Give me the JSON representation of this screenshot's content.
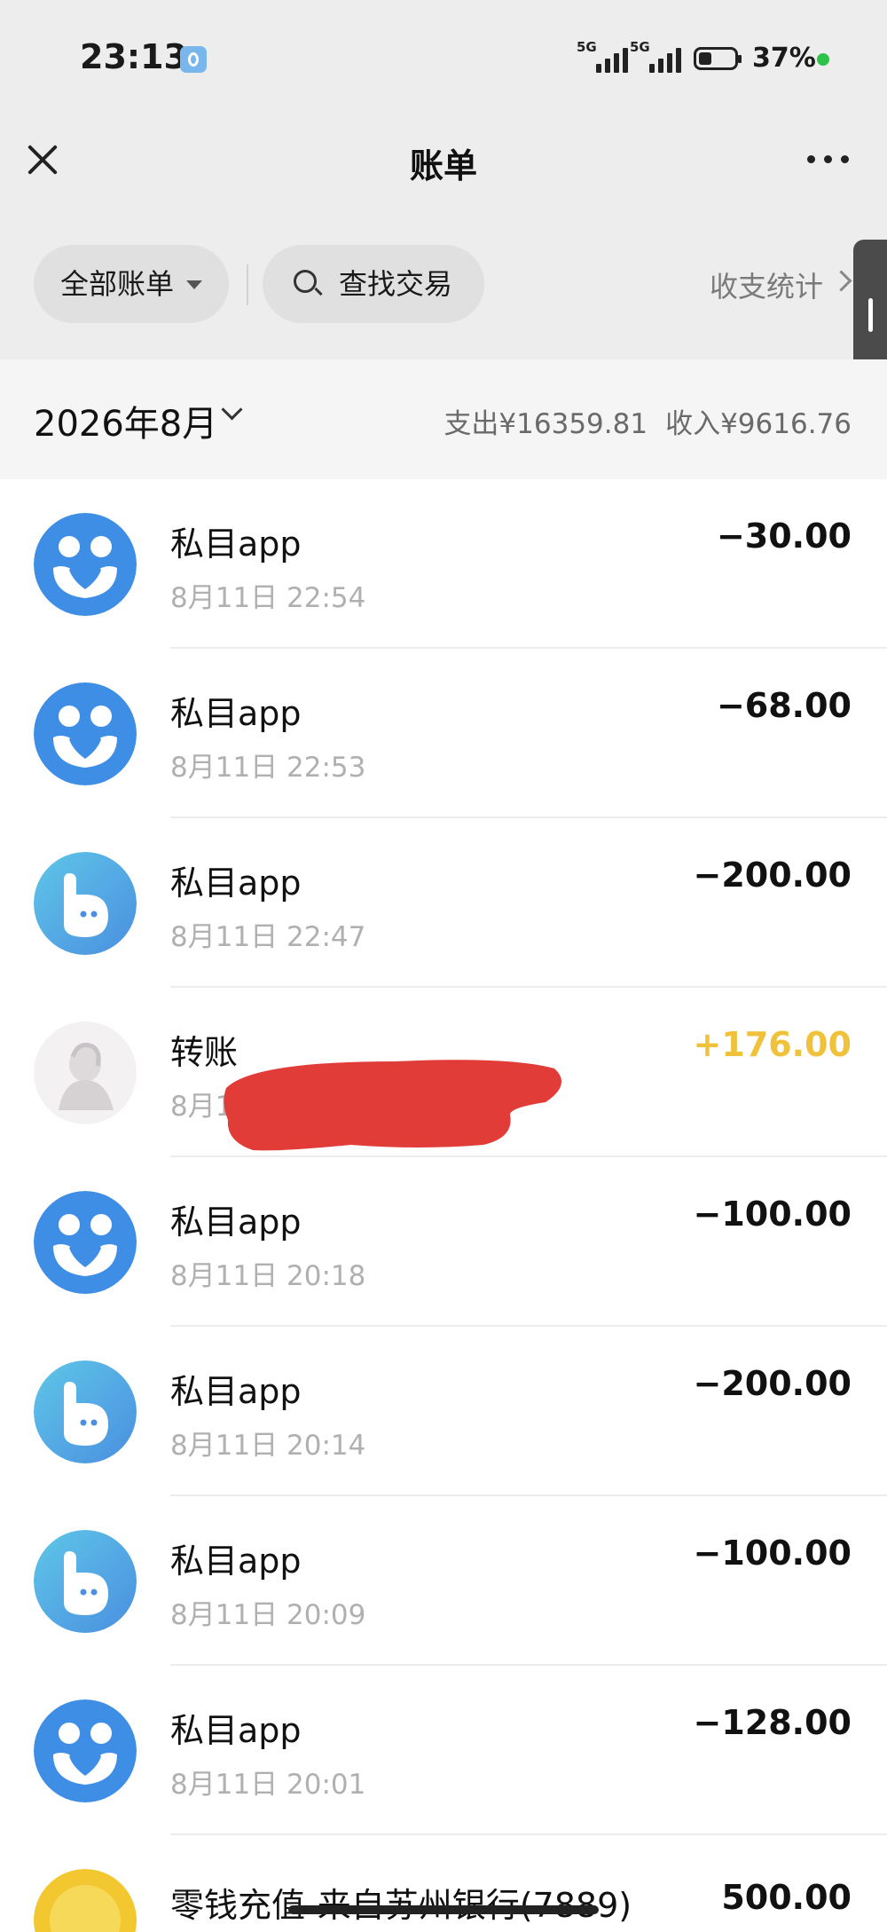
{
  "status_bar": {
    "time": "23:13",
    "signal_1": "5G",
    "signal_2": "5G",
    "battery_percent": "37%"
  },
  "nav": {
    "title": "账单"
  },
  "filters": {
    "all_bills": "全部账单",
    "search": "查找交易",
    "stats": "收支统计"
  },
  "month": {
    "label": "2026年8月",
    "expense": "支出¥16359.81",
    "income": "收入¥9616.76"
  },
  "transactions": [
    {
      "name": "私目app",
      "time": "8月11日 22:54",
      "amount": "−30.00",
      "icon": "heart-hands-icon"
    },
    {
      "name": "私目app",
      "time": "8月11日 22:53",
      "amount": "−68.00",
      "icon": "heart-hands-icon"
    },
    {
      "name": "私目app",
      "time": "8月11日 22:47",
      "amount": "−200.00",
      "icon": "b-mascot-icon"
    },
    {
      "name": "转账",
      "time": "8月11日",
      "amount": "+176.00",
      "icon": "contact-avatar"
    },
    {
      "name": "私目app",
      "time": "8月11日 20:18",
      "amount": "−100.00",
      "icon": "heart-hands-icon"
    },
    {
      "name": "私目app",
      "time": "8月11日 20:14",
      "amount": "−200.00",
      "icon": "b-mascot-icon"
    },
    {
      "name": "私目app",
      "time": "8月11日 20:09",
      "amount": "−100.00",
      "icon": "b-mascot-icon"
    },
    {
      "name": "私目app",
      "time": "8月11日 20:01",
      "amount": "−128.00",
      "icon": "heart-hands-icon"
    },
    {
      "name": "零钱充值-来自苏州银行(7889)",
      "amount": "500.00",
      "icon": "coin-icon"
    }
  ],
  "colors": {
    "brand_blue": "#3e8ee6",
    "income_yellow": "#f0c23c",
    "redaction_red": "#e23c39"
  }
}
